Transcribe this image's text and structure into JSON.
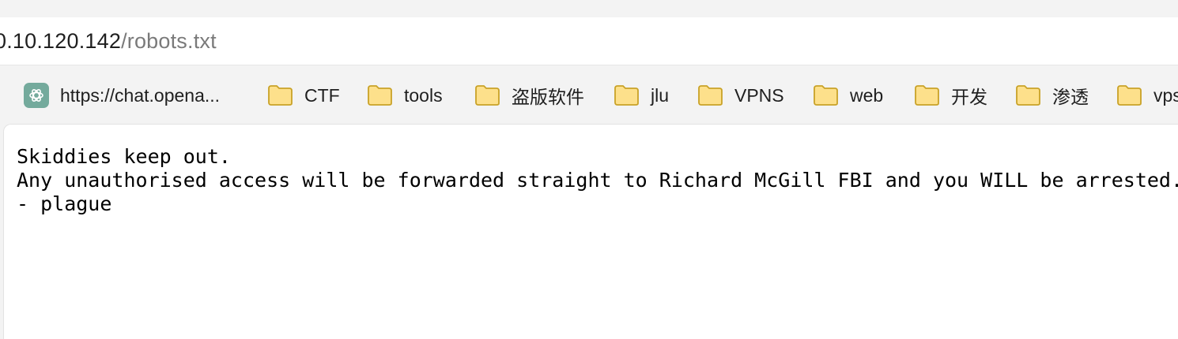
{
  "address_bar": {
    "host": "0.10.120.142",
    "path": "/robots.txt"
  },
  "bookmarks": [
    {
      "label": "https://chat.opena...",
      "icon": "chatgpt-icon"
    },
    {
      "label": "CTF",
      "icon": "folder-icon"
    },
    {
      "label": "tools",
      "icon": "folder-icon"
    },
    {
      "label": "盗版软件",
      "icon": "folder-icon"
    },
    {
      "label": "jlu",
      "icon": "folder-icon"
    },
    {
      "label": "VPNS",
      "icon": "folder-icon"
    },
    {
      "label": "web",
      "icon": "folder-icon"
    },
    {
      "label": "开发",
      "icon": "folder-icon"
    },
    {
      "label": "渗透",
      "icon": "folder-icon"
    },
    {
      "label": "vps",
      "icon": "folder-icon"
    }
  ],
  "page": {
    "lines": [
      "Skiddies keep out.",
      "Any unauthorised access will be forwarded straight to Richard McGill FBI and you WILL be arrested.",
      "- plague"
    ]
  },
  "colors": {
    "folder_fill": "#fde08b",
    "folder_stroke": "#c9a227",
    "chatgpt_bg": "#74aa9c"
  }
}
